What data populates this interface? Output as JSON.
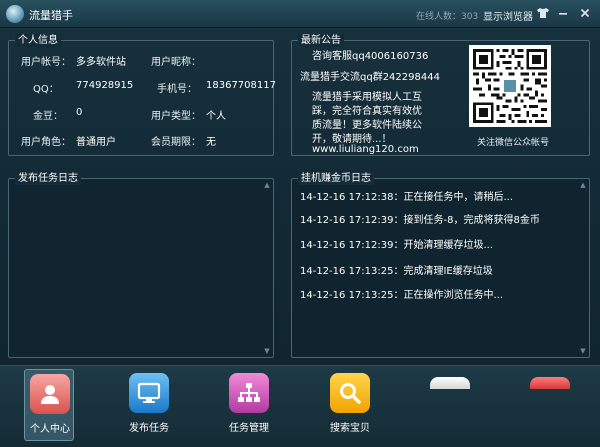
{
  "window": {
    "title": "流量猎手",
    "online_count": "在线人数：303",
    "show_browser": "显示浏览器"
  },
  "personal_info": {
    "title": "个人信息",
    "fields": [
      {
        "label": "用户帐号：",
        "value": "多多软件站"
      },
      {
        "label": "用户昵称：",
        "value": ""
      },
      {
        "label": "QQ：",
        "value": "774928915"
      },
      {
        "label": "手机号：",
        "value": "18367708117"
      },
      {
        "label": "金豆：",
        "value": "0"
      },
      {
        "label": "用户类型：",
        "value": "个人"
      },
      {
        "label": "用户角色：",
        "value": "普通用户"
      },
      {
        "label": "会员期限：",
        "value": "无"
      }
    ]
  },
  "notice": {
    "title": "最新公告",
    "lines": [
      "咨询客服qq4006160736",
      "流量猎手交流qq群242298444",
      "流量猎手采用模拟人工互",
      "踩，完全符合真实有效优",
      "质流量！更多软件陆续公",
      "开，敬请期待...！",
      "www.liuliang120.com"
    ],
    "qr_caption": "关注微信公众帐号"
  },
  "publish_log": {
    "title": "发布任务日志"
  },
  "hang_log": {
    "title": "挂机赚金币日志",
    "lines": [
      "14-12-16 17:12:38：正在接任务中，请稍后...",
      "14-12-16 17:12:39：接到任务-8，完成将获得8金币",
      "14-12-16 17:12:39：开始清理缓存垃圾...",
      "14-12-16 17:13:25：完成清理IE缓存垃圾",
      "14-12-16 17:13:25：正在操作浏览任务中..."
    ]
  },
  "dock": {
    "items": [
      {
        "label": "个人中心",
        "icon": "user-icon"
      },
      {
        "label": "发布任务",
        "icon": "monitor-icon"
      },
      {
        "label": "任务管理",
        "icon": "org-chart-icon"
      },
      {
        "label": "搜索宝贝",
        "icon": "search-icon"
      }
    ]
  }
}
